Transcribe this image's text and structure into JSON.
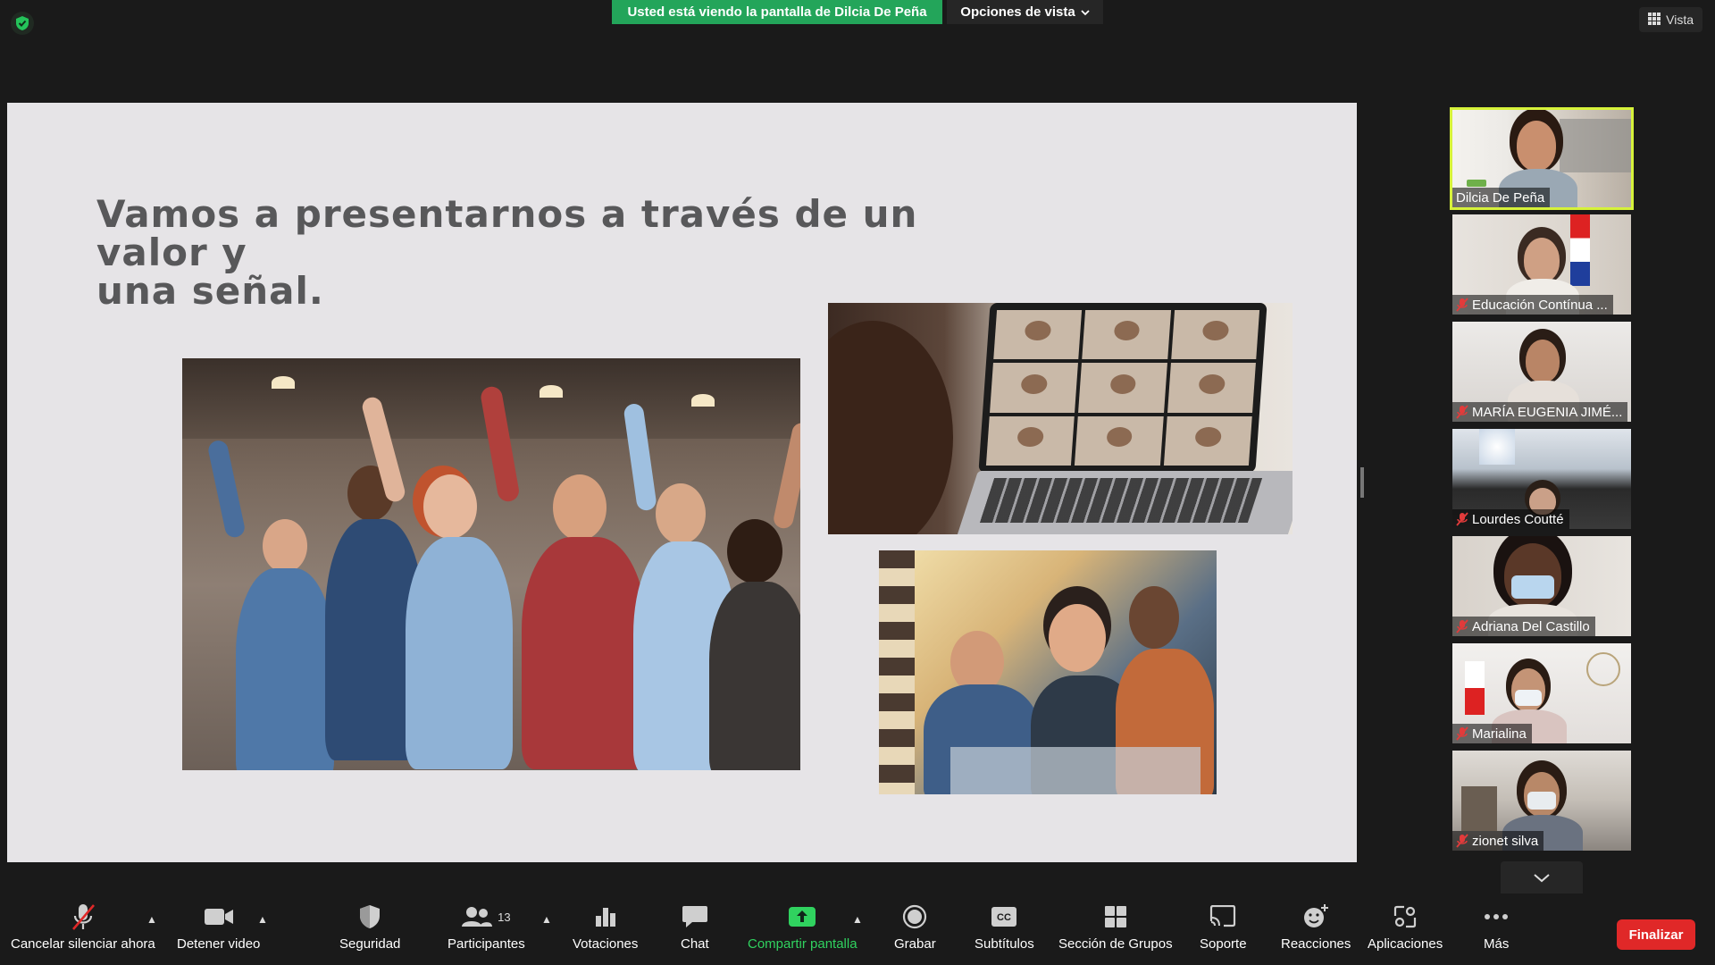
{
  "top": {
    "share_banner": "Usted está viendo la pantalla de Dilcia De Peña",
    "view_options": "Opciones de vista",
    "view_button": "Vista"
  },
  "slide": {
    "title_line1": "Vamos a presentarnos a través de un valor y",
    "title_line2": "una señal."
  },
  "gallery": [
    {
      "name": "Dilcia De Peña",
      "muted": false,
      "active_speaker": true
    },
    {
      "name": "Educación Contínua ...",
      "muted": true,
      "active_speaker": false
    },
    {
      "name": "MARÍA EUGENIA JIMÉ...",
      "muted": true,
      "active_speaker": false
    },
    {
      "name": "Lourdes Coutté",
      "muted": true,
      "active_speaker": false
    },
    {
      "name": "Adriana Del Castillo",
      "muted": true,
      "active_speaker": false
    },
    {
      "name": "Marialina",
      "muted": true,
      "active_speaker": false
    },
    {
      "name": "zionet silva",
      "muted": true,
      "active_speaker": false
    }
  ],
  "toolbar": {
    "unmute": "Cancelar silenciar ahora",
    "stop_video": "Detener video",
    "security": "Seguridad",
    "participants": "Participantes",
    "participants_count": "13",
    "polls": "Votaciones",
    "chat": "Chat",
    "share_screen": "Compartir pantalla",
    "record": "Grabar",
    "captions": "Subtítulos",
    "breakout": "Sección de Grupos",
    "support": "Soporte",
    "reactions": "Reacciones",
    "apps": "Aplicaciones",
    "more": "Más",
    "end": "Finalizar"
  },
  "colors": {
    "share_green": "#23a55a",
    "speaker_highlight": "#d6f23a",
    "end_red": "#e02828",
    "slide_bg": "#e6e4e7",
    "title_gray": "#58585a"
  }
}
